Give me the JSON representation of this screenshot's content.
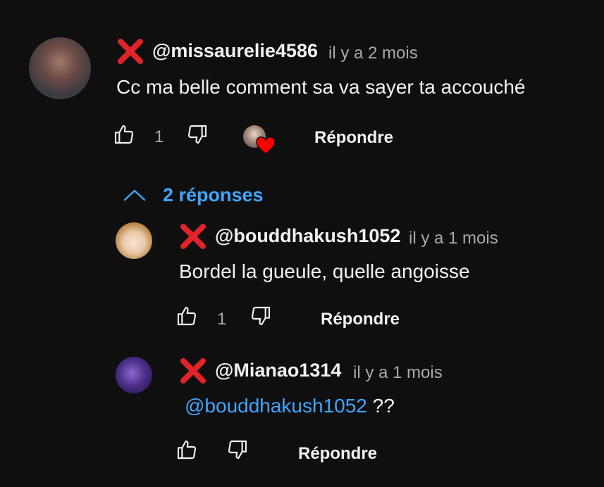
{
  "comment": {
    "author": "@missaurelie4586",
    "time": "il y a 2 mois",
    "text": "Cc ma belle comment sa va sayer ta accouché",
    "likes": "1",
    "reply_label": "Répondre"
  },
  "replies_toggle": {
    "label": "2 réponses",
    "icon": "chevron-up-icon"
  },
  "replies": [
    {
      "author": "@bouddhakush1052",
      "time": "il y a 1 mois",
      "text": "Bordel la gueule, quelle angoisse",
      "likes": "1",
      "reply_label": "Répondre"
    },
    {
      "author": "@Mianao1314",
      "time": "il y a 1 mois",
      "mention": "@bouddhakush1052",
      "text": " ??",
      "reply_label": "Répondre"
    }
  ],
  "colors": {
    "background": "#0f0f0f",
    "link": "#3ea6ff",
    "x_mark": "#e0242a",
    "heart": "#ff0000"
  }
}
